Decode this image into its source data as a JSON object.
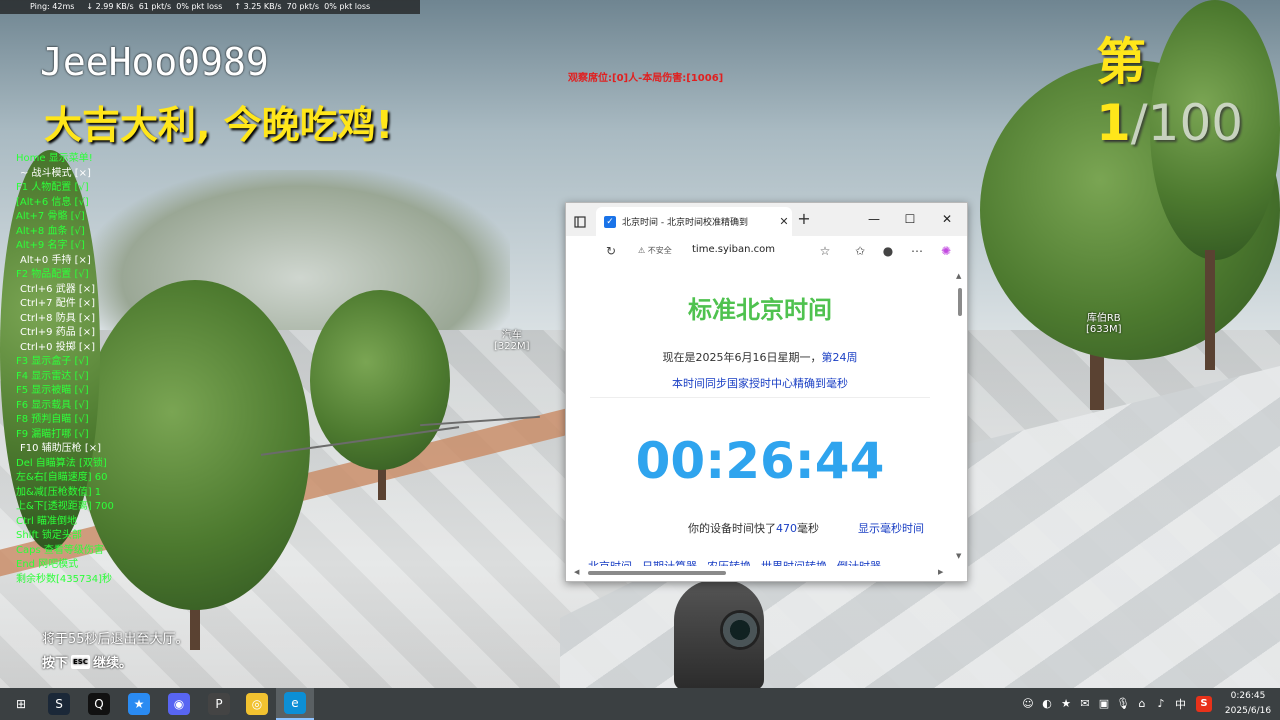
{
  "netbar": {
    "ping": "Ping: 42ms",
    "down_rate": "2.99 KB/s",
    "down_pkt": "61 pkt/s",
    "down_loss": "0% pkt loss",
    "up_rate": "3.25 KB/s",
    "up_pkt": "70 pkt/s",
    "up_loss": "0% pkt loss"
  },
  "hud": {
    "player_name": "JeeHoo0989",
    "win_message": "大吉大利, 今晚吃鸡!",
    "rank_prefix": "第1",
    "rank_total": "/100",
    "red_status": "观察席位:[0]人-本局伤害:[1006]",
    "marker_vehicle_name": "汽车",
    "marker_vehicle_dist": "[322M]",
    "marker_player_name": "库伯RB",
    "marker_player_dist": "[633M]",
    "exit_message": "将于55秒后退出至大厅。",
    "press_prefix": "按下",
    "press_key": "ESC",
    "press_suffix": "继续。"
  },
  "cheat_menu": [
    {
      "text": "Home 显示菜单!",
      "color": "green"
    },
    {
      "text": "~ 战斗模式 [×]",
      "color": "white"
    },
    {
      "text": "F1 人物配置 [√]",
      "color": "green"
    },
    {
      "text": "[Alt+6 信息 [√]",
      "color": "green"
    },
    {
      "text": "Alt+7 骨骼 [√]",
      "color": "green"
    },
    {
      "text": "Alt+8 血条 [√]",
      "color": "green"
    },
    {
      "text": "Alt+9 名字 [√]",
      "color": "green"
    },
    {
      "text": "Alt+0 手持 [×]",
      "color": "white"
    },
    {
      "text": "F2 物品配置 [√]",
      "color": "green"
    },
    {
      "text": "Ctrl+6 武器 [×]",
      "color": "white"
    },
    {
      "text": "Ctrl+7 配件 [×]",
      "color": "white"
    },
    {
      "text": "Ctrl+8 防具 [×]",
      "color": "white"
    },
    {
      "text": "Ctrl+9 药品 [×]",
      "color": "white"
    },
    {
      "text": "Ctrl+0 投掷 [×]",
      "color": "white"
    },
    {
      "text": "F3 显示盒子 [√]",
      "color": "green"
    },
    {
      "text": "F4 显示雷达 [√]",
      "color": "green"
    },
    {
      "text": "F5 显示被瞄 [√]",
      "color": "green"
    },
    {
      "text": "F6 显示载具 [√]",
      "color": "green"
    },
    {
      "text": "F8 预判自瞄 [√]",
      "color": "green"
    },
    {
      "text": "F9 漏瞄打哪 [√]",
      "color": "green"
    },
    {
      "text": "F10 辅助压枪 [×]",
      "color": "white"
    },
    {
      "text": "Del 自瞄算法 [双锁]",
      "color": "green"
    },
    {
      "text": "左&右[自瞄速度] 60",
      "color": "green"
    },
    {
      "text": "加&减[压枪数值] 1",
      "color": "green"
    },
    {
      "text": "上&下[透视距离] 700",
      "color": "green"
    },
    {
      "text": "Ctrl 瞄准倒地",
      "color": "green"
    },
    {
      "text": "Shift 锁定头部",
      "color": "green"
    },
    {
      "text": "Caps 查看等级伤害",
      "color": "green"
    },
    {
      "text": "End 网吧模式",
      "color": "green"
    },
    {
      "text": "剩余秒数[435734]秒",
      "color": "green"
    }
  ],
  "browser": {
    "tab_title": "北京时间 - 北京时间校准精确到",
    "security_label": "不安全",
    "url": "time.syiban.com",
    "page_title": "标准北京时间",
    "date_prefix": "现在是2025年6月16日星期一，",
    "week_label": "第24周",
    "sync_text": "本时间同步国家授时中心精确到毫秒",
    "clock": "00:26:44",
    "diff_prefix": "你的设备时间快了",
    "diff_value": "470",
    "diff_suffix": "毫秒",
    "show_ms_link": "显示毫秒时间",
    "bottom_links": [
      "北京时间",
      "日期计算器",
      "农历转换",
      "世界时间转换",
      "倒计时器"
    ]
  },
  "taskbar": {
    "apps": [
      {
        "name": "windows-start",
        "glyph": "⊞",
        "color": "#3b4042"
      },
      {
        "name": "steam",
        "glyph": "S",
        "color": "#1b2838"
      },
      {
        "name": "qq",
        "glyph": "Q",
        "color": "#111111"
      },
      {
        "name": "star-app",
        "glyph": "★",
        "color": "#2a8bf2"
      },
      {
        "name": "discord-like",
        "glyph": "◉",
        "color": "#5865f2"
      },
      {
        "name": "pubg",
        "glyph": "P",
        "color": "#444444"
      },
      {
        "name": "owl-app",
        "glyph": "◎",
        "color": "#f2c230"
      },
      {
        "name": "edge",
        "glyph": "e",
        "color": "#0c8fd6"
      }
    ],
    "lang": "中",
    "sogou": "S",
    "time": "0:26:45",
    "date": "2025/6/16"
  },
  "colors": {
    "hud_yellow": "#ffe61a",
    "menu_green": "#2dff3a",
    "clock_blue": "#2fa4ee",
    "title_green": "#4fc24f",
    "link_blue": "#1a3fc4",
    "taskbar_bg": "#3b4042"
  }
}
